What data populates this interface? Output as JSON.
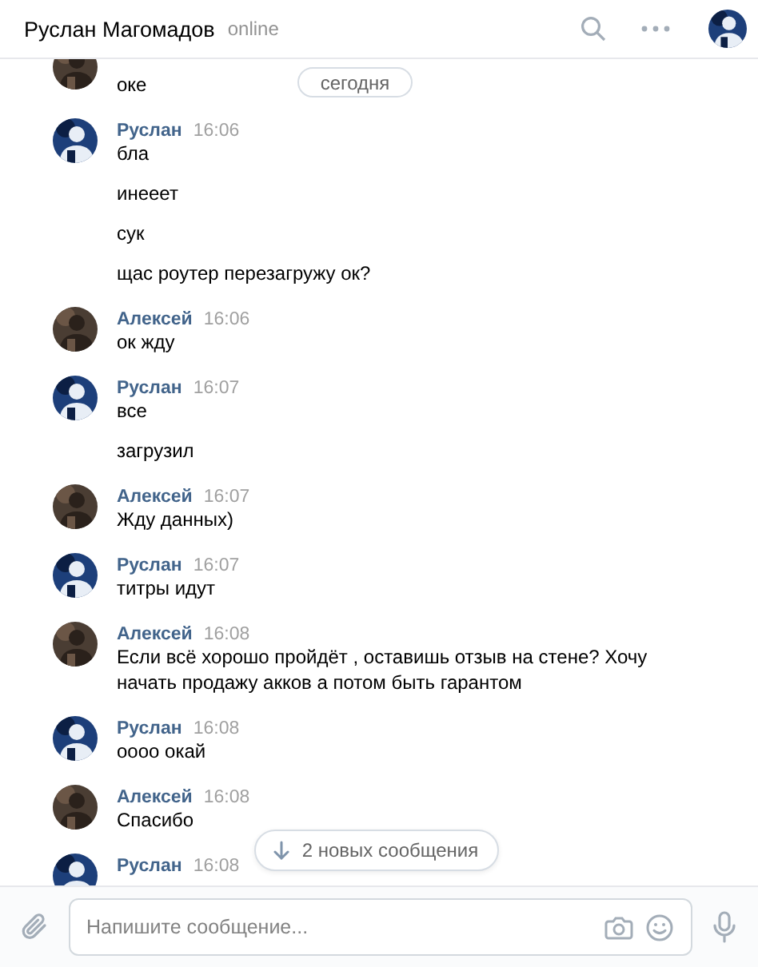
{
  "header": {
    "name": "Руслан Магомадов",
    "status": "online"
  },
  "date_pill": "сегодня",
  "groups": [
    {
      "kind": "self",
      "messages": [
        "оке"
      ]
    },
    {
      "kind": "peer",
      "author": "Руслан",
      "time": "16:06",
      "messages": [
        "бла",
        "инееет",
        "сук",
        "щас роутер перезагружу ок?"
      ]
    },
    {
      "kind": "self",
      "author": "Алексей",
      "time": "16:06",
      "messages": [
        "ок жду"
      ]
    },
    {
      "kind": "peer",
      "author": "Руслан",
      "time": "16:07",
      "messages": [
        "все",
        "загрузил"
      ]
    },
    {
      "kind": "self",
      "author": "Алексей",
      "time": "16:07",
      "messages": [
        "Жду данных)"
      ]
    },
    {
      "kind": "peer",
      "author": "Руслан",
      "time": "16:07",
      "messages": [
        "титры идут"
      ]
    },
    {
      "kind": "self",
      "author": "Алексей",
      "time": "16:08",
      "messages": [
        "Если всё хорошо пройдёт , оставишь отзыв на стене? Хочу начать продажу акков а потом быть гарантом"
      ]
    },
    {
      "kind": "peer",
      "author": "Руслан",
      "time": "16:08",
      "messages": [
        "оооо окай"
      ]
    },
    {
      "kind": "self",
      "author": "Алексей",
      "time": "16:08",
      "messages": [
        "Спасибо"
      ]
    },
    {
      "kind": "peer",
      "author": "Руслан",
      "time": "16:08"
    }
  ],
  "new_messages_pill": "2 новых сообщения",
  "composer": {
    "placeholder": "Напишите сообщение..."
  }
}
